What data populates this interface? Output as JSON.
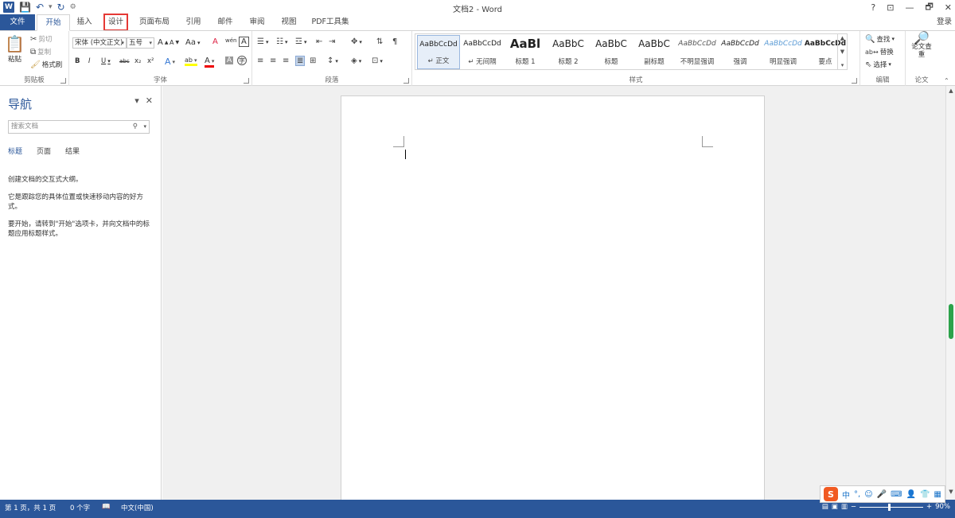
{
  "window": {
    "title": "文档2 - Word",
    "controls": {
      "help": "?",
      "ribbon_display": "⊡",
      "minimize": "—",
      "restore": "🗗",
      "close": "✕"
    },
    "login": "登录"
  },
  "qat": {
    "logo": "W",
    "save": "💾",
    "undo": "↶",
    "undo_arrow": "▾",
    "redo": "↻",
    "customize": "⚙"
  },
  "tabs": [
    {
      "label": "文件"
    },
    {
      "label": "开始"
    },
    {
      "label": "插入"
    },
    {
      "label": "设计"
    },
    {
      "label": "页面布局"
    },
    {
      "label": "引用"
    },
    {
      "label": "邮件"
    },
    {
      "label": "审阅"
    },
    {
      "label": "视图"
    },
    {
      "label": "PDF工具集"
    }
  ],
  "ribbon": {
    "clipboard": {
      "label": "剪贴板",
      "paste": "粘贴",
      "cut": "剪切",
      "copy": "复制",
      "format_painter": "格式刷"
    },
    "font": {
      "label": "字体",
      "font_name": "宋体 (中文正文)",
      "font_size": "五号",
      "grow": "A",
      "shrink": "A",
      "change_case": "Aa",
      "clear_format": "A",
      "phonetic": "wén",
      "char_border": "A",
      "bold": "B",
      "italic": "I",
      "underline": "U",
      "strikethrough": "abc",
      "subscript": "x₂",
      "superscript": "x²",
      "text_effects": "A",
      "highlight": "ab",
      "font_color": "A",
      "char_shading": "A",
      "enclose": "字"
    },
    "paragraph": {
      "label": "段落"
    },
    "styles": {
      "label": "样式",
      "items": [
        {
          "sample": "AaBbCcDd",
          "name": "↵ 正文"
        },
        {
          "sample": "AaBbCcDd",
          "name": "↵ 无间隔"
        },
        {
          "sample": "AaBl",
          "name": "标题 1"
        },
        {
          "sample": "AaBbC",
          "name": "标题 2"
        },
        {
          "sample": "AaBbC",
          "name": "标题"
        },
        {
          "sample": "AaBbC",
          "name": "副标题"
        },
        {
          "sample": "AaBbCcDd",
          "name": "不明显强调"
        },
        {
          "sample": "AaBbCcDd",
          "name": "强调"
        },
        {
          "sample": "AaBbCcDd",
          "name": "明显强调"
        },
        {
          "sample": "AaBbCcDd",
          "name": "要点"
        }
      ]
    },
    "editing": {
      "label": "编辑",
      "find": "查找",
      "replace": "替换",
      "select": "选择"
    },
    "paper": {
      "label": "论文",
      "check": "论文查重"
    }
  },
  "nav": {
    "title": "导航",
    "search_placeholder": "搜索文档",
    "tabs": [
      "标题",
      "页面",
      "结果"
    ],
    "text1": "创建文档的交互式大纲。",
    "text2": "它是跟踪您的具体位置或快速移动内容的好方式。",
    "text3": "要开始，请转到\"开始\"选项卡，并向文档中的标题应用标题样式。"
  },
  "status": {
    "page": "第 1 页，共 1 页",
    "words": "0 个字",
    "language": "中文(中国)",
    "zoom": "90%",
    "zoom_minus": "−",
    "zoom_plus": "+"
  },
  "ime": {
    "logo": "S",
    "mode": "中",
    "punct": "°,",
    "emoji": "☺",
    "voice": "🎤",
    "keyboard": "⌨",
    "user": "👤",
    "skin": "👕",
    "tools": "▦"
  },
  "colors": {
    "accent": "#2b579a",
    "highlight_box": "#e53935",
    "scroll_thumb": "#2ca34b"
  }
}
